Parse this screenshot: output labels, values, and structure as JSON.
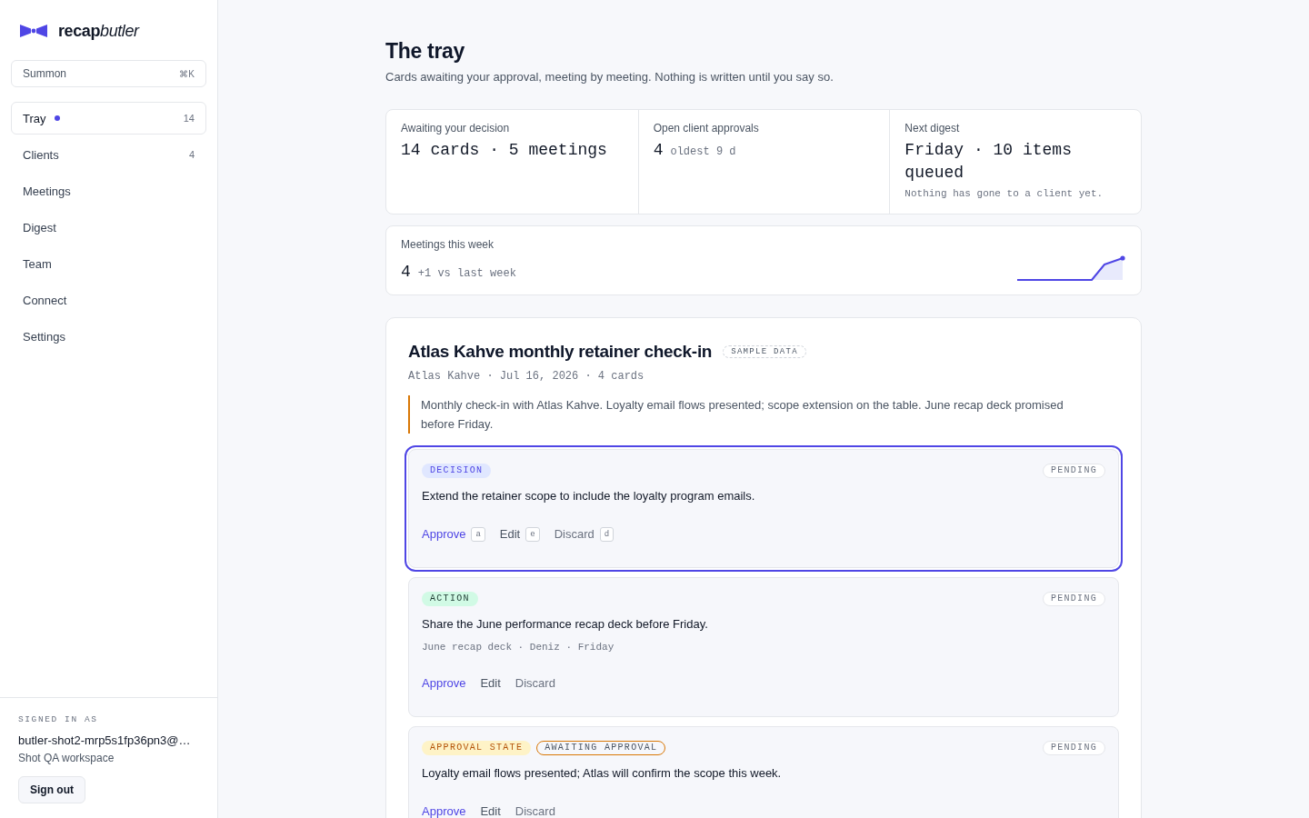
{
  "sidebar": {
    "logo": {
      "bold_part": "recap",
      "italic_part": "butler"
    },
    "summon": {
      "label": "Summon",
      "shortcut": "⌘K"
    },
    "nav": [
      {
        "label": "Tray",
        "selected": true,
        "indicator": true,
        "count": "14"
      },
      {
        "label": "Clients",
        "selected": false,
        "indicator": false,
        "count": "4"
      },
      {
        "label": "Meetings",
        "selected": false,
        "indicator": false
      },
      {
        "label": "Digest",
        "selected": false,
        "indicator": false
      },
      {
        "label": "Team",
        "selected": false,
        "indicator": false
      },
      {
        "label": "Connect",
        "selected": false,
        "indicator": false
      },
      {
        "label": "Settings",
        "selected": false,
        "indicator": false
      }
    ],
    "account": {
      "heading": "SIGNED IN AS",
      "email": "butler-shot2-mrp5s1fp36pn3@…",
      "workspace": "Shot QA workspace",
      "sign_out": "Sign out"
    }
  },
  "page": {
    "title": "The tray",
    "subtitle": "Cards awaiting your approval, meeting by meeting. Nothing is written until you say so."
  },
  "stats": [
    {
      "label": "Awaiting your decision",
      "value": "14 cards · 5 meetings"
    },
    {
      "label": "Open client approvals",
      "value": "4",
      "detail": "oldest 9 d"
    },
    {
      "label": "Next digest",
      "value": "Friday · 10 items queued",
      "note": "Nothing has gone to a client yet."
    }
  ],
  "weekly": {
    "label": "Meetings this week",
    "value": "4",
    "detail": "+1 vs last week"
  },
  "meeting": {
    "title": "Atlas Kahve monthly retainer check-in",
    "badge": "SAMPLE DATA",
    "meta": "Atlas Kahve · Jul 16, 2026 · 4 cards",
    "summary": "Monthly check-in with Atlas Kahve. Loyalty email flows presented; scope extension on the table. June recap deck promised before Friday.",
    "cards": [
      {
        "kind": "decision",
        "tag": "DECISION",
        "status": "PENDING",
        "selected": true,
        "text": "Extend the retainer scope to include the loyalty program emails.",
        "actions": [
          {
            "kind": "approve",
            "label": "Approve",
            "key": "a"
          },
          {
            "kind": "edit",
            "label": "Edit",
            "key": "e"
          },
          {
            "kind": "discard",
            "label": "Discard",
            "key": "d"
          }
        ]
      },
      {
        "kind": "action",
        "tag": "ACTION",
        "status": "PENDING",
        "selected": false,
        "text": "Share the June performance recap deck before Friday.",
        "detail": "June recap deck · Deniz · Friday",
        "actions": [
          {
            "kind": "approve",
            "label": "Approve"
          },
          {
            "kind": "edit",
            "label": "Edit"
          },
          {
            "kind": "discard",
            "label": "Discard"
          }
        ]
      },
      {
        "kind": "approval_state",
        "tag": "APPROVAL STATE",
        "state_badge": "AWAITING APPROVAL",
        "status": "PENDING",
        "selected": false,
        "text": "Loyalty email flows presented; Atlas will confirm the scope this week.",
        "actions": [
          {
            "kind": "approve",
            "label": "Approve"
          },
          {
            "kind": "edit",
            "label": "Edit"
          },
          {
            "kind": "discard",
            "label": "Discard"
          }
        ]
      }
    ]
  }
}
